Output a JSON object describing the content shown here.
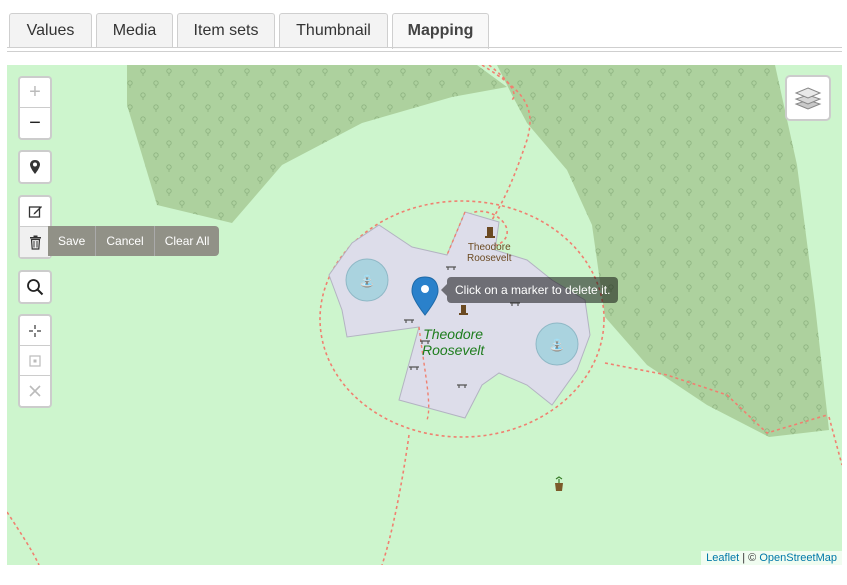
{
  "tabs": [
    {
      "label": "Values",
      "active": false
    },
    {
      "label": "Media",
      "active": false
    },
    {
      "label": "Item sets",
      "active": false
    },
    {
      "label": "Thumbnail",
      "active": false
    },
    {
      "label": "Mapping",
      "active": true
    }
  ],
  "map": {
    "zoom_in_label": "+",
    "zoom_out_label": "−",
    "tooltip": "Click on a marker to delete it.",
    "edit_actions": {
      "save": "Save",
      "cancel": "Cancel",
      "clear_all": "Clear All"
    },
    "labels": {
      "park_line1": "Theodore",
      "park_line2": "Roosevelt",
      "statue_line1": "Theodore",
      "statue_line2": "Roosevelt"
    },
    "attribution": {
      "leaflet": "Leaflet",
      "separator": " | © ",
      "osm": "OpenStreetMap"
    },
    "colors": {
      "background": "#cdf5cd",
      "forest": "#add19e",
      "plaza": "#ddddea",
      "path": "#f08070",
      "marker": "#2a81cb"
    }
  }
}
